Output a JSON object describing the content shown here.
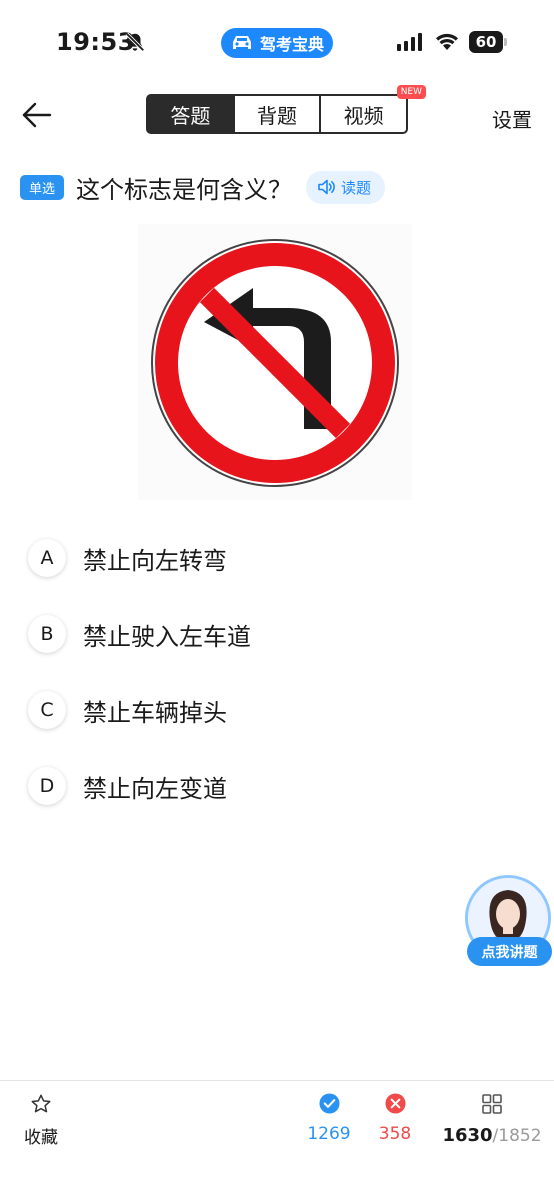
{
  "status_bar": {
    "time": "19:53",
    "app_name": "驾考宝典",
    "battery": "60",
    "icons": [
      "bell-off-icon",
      "signal-icon",
      "wifi-icon",
      "battery-icon"
    ]
  },
  "nav": {
    "back_icon": "arrow-left-icon",
    "tabs": [
      {
        "label": "答题",
        "active": true
      },
      {
        "label": "背题",
        "active": false
      },
      {
        "label": "视频",
        "active": false
      }
    ],
    "new_badge": "NEW",
    "settings_label": "设置"
  },
  "question": {
    "type_tag": "单选",
    "text": "这个标志是何含义？",
    "read_label": "读题"
  },
  "sign": {
    "description": "no-left-turn-sign",
    "colors": {
      "ring": "#e8141c",
      "arrow": "#1c1c1c",
      "background": "#ffffff"
    }
  },
  "options": [
    {
      "letter": "A",
      "text": "禁止向左转弯"
    },
    {
      "letter": "B",
      "text": "禁止驶入左车道"
    },
    {
      "letter": "C",
      "text": "禁止车辆掉头"
    },
    {
      "letter": "D",
      "text": "禁止向左变道"
    }
  ],
  "helper": {
    "label": "点我讲题"
  },
  "bottom_bar": {
    "favorite_label": "收藏",
    "correct_count": "1269",
    "wrong_count": "358",
    "current": "1630",
    "total": "/1852"
  },
  "colors": {
    "accent": "#1e88ff",
    "correct": "#2a93f2",
    "wrong": "#f04a4a",
    "tab_active": "#2b2b2b"
  }
}
